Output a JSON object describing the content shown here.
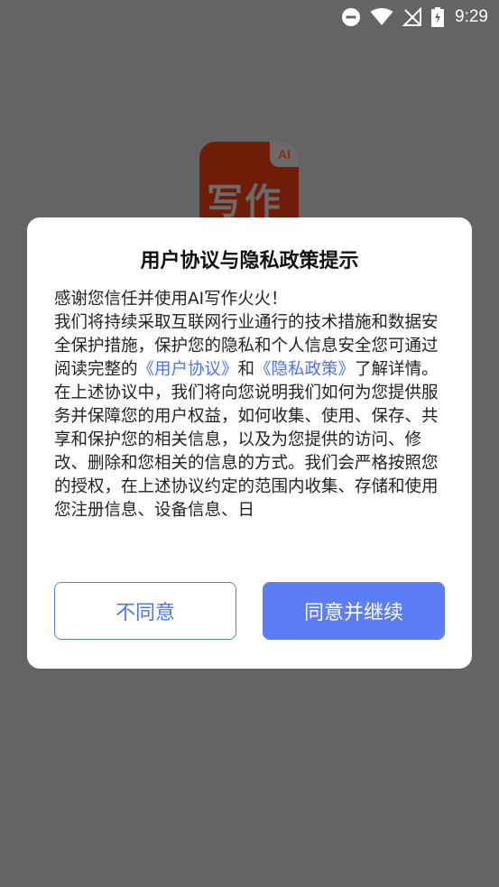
{
  "status_bar": {
    "time": "9:29",
    "icons": [
      "do-not-disturb-icon",
      "wifi-icon",
      "no-signal-icon",
      "battery-charging-icon"
    ]
  },
  "background_app": {
    "logo_badge": "AI",
    "logo_text": "写作"
  },
  "dialog": {
    "title": "用户协议与隐私政策提示",
    "body": {
      "p1": "感谢您信任并使用AI写作火火！",
      "p2_text": "我们将持续采取互联网行业通行的技术措施和数据安全保护措施，保护您的隐私和个人信息安全您可通过阅读完整的",
      "user_agreement_link": "《用户协议》",
      "and": "和",
      "privacy_policy_link": "《隐私政策》",
      "p2_tail": "了解详情。",
      "p3": "在上述协议中，我们将向您说明我们如何为您提供服务并保障您的用户权益，如何收集、使用、保存、共享和保护您的相关信息，以及为您提供的访问、修改、删除和您相关的信息的方式。我们会严格按照您的授权，在上述协议约定的范围内收集、存储和使用您注册信息、设备信息、日"
    },
    "decline_label": "不同意",
    "accept_label": "同意并继续"
  },
  "colors": {
    "scrim": "#646464",
    "accent": "#5b7ef7",
    "link": "#4b74f0",
    "logo": "#6f1d06"
  }
}
